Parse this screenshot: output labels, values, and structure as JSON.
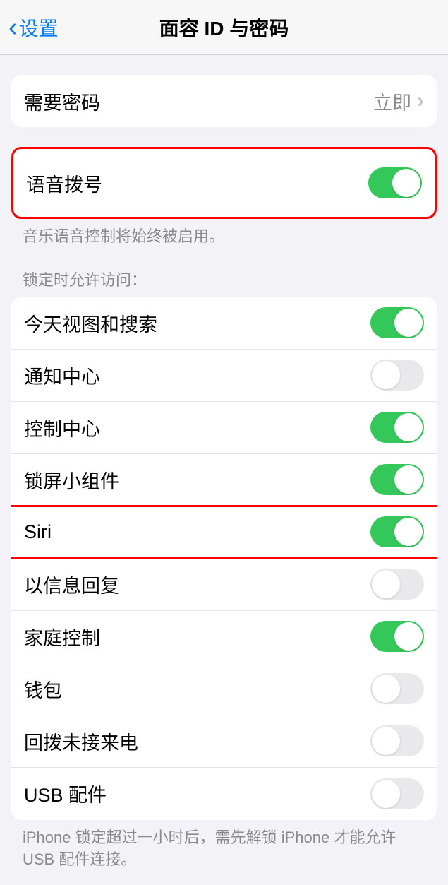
{
  "header": {
    "back_label": "设置",
    "title": "面容 ID 与密码"
  },
  "require_passcode": {
    "label": "需要密码",
    "value": "立即"
  },
  "voice_dial": {
    "label": "语音拨号",
    "enabled": true,
    "footer": "音乐语音控制将始终被启用。"
  },
  "lock_access": {
    "header": "锁定时允许访问：",
    "items": [
      {
        "label": "今天视图和搜索",
        "enabled": true
      },
      {
        "label": "通知中心",
        "enabled": false
      },
      {
        "label": "控制中心",
        "enabled": true
      },
      {
        "label": "锁屏小组件",
        "enabled": true
      },
      {
        "label": "Siri",
        "enabled": true
      },
      {
        "label": "以信息回复",
        "enabled": false
      },
      {
        "label": "家庭控制",
        "enabled": true
      },
      {
        "label": "钱包",
        "enabled": false
      },
      {
        "label": "回拨未接来电",
        "enabled": false
      },
      {
        "label": "USB 配件",
        "enabled": false
      }
    ],
    "footer": "iPhone 锁定超过一小时后，需先解锁 iPhone 才能允许 USB 配件连接。"
  }
}
